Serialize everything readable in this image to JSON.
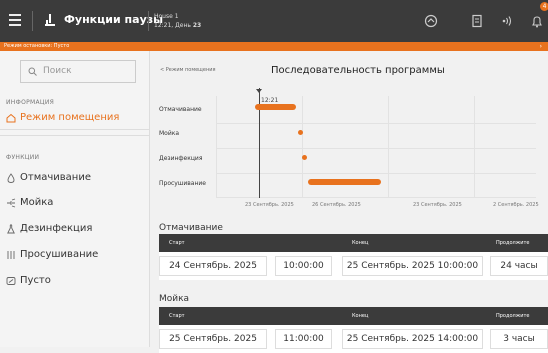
{
  "topbar": {
    "title": "Функции паузы",
    "house_line1": "House 1",
    "house_line2_prefix": "12:21, День ",
    "house_line2_day": "23",
    "badge": "4"
  },
  "statusbar": {
    "text": "Режим остановки: Пусто",
    "icon": "chevron-icon"
  },
  "sidebar": {
    "search_placeholder": "Поиск",
    "info_label": "ИНФОРМАЦИЯ",
    "functions_label": "ФУНКЦИИ",
    "items_info": [
      {
        "label": "Режим помещения",
        "icon": "home-icon",
        "active": true
      }
    ],
    "items_functions": [
      {
        "label": "Отмачивание",
        "icon": "drop-icon"
      },
      {
        "label": "Мойка",
        "icon": "spray-icon"
      },
      {
        "label": "Дезинфекция",
        "icon": "flask-icon"
      },
      {
        "label": "Просушивание",
        "icon": "heat-icon"
      },
      {
        "label": "Пусто",
        "icon": "empty-icon"
      }
    ]
  },
  "main": {
    "breadcrumb": "< Режим помещения",
    "title": "Последовательность программы"
  },
  "chart_data": {
    "type": "gantt",
    "now_label": "12:21",
    "rows": [
      {
        "name": "Отмачивание",
        "start": "2025-09-24T10:00",
        "end": "2025-09-25T10:00"
      },
      {
        "name": "Мойка",
        "start": "2025-09-25T11:00",
        "end": "2025-09-25T14:00"
      },
      {
        "name": "Дезинфекция",
        "start": "2025-09-25T14:00",
        "end": "2025-09-25T16:00"
      },
      {
        "name": "Просушивание",
        "start": "2025-09-25T17:00",
        "end": "2025-09-27T12:00"
      }
    ],
    "x_ticks": [
      "23 Сентябрь. 2025",
      "26 Сентябрь. 2025",
      "23 Сентябрь. 2025",
      "2 Сентябрь. 2025"
    ]
  },
  "sections": [
    {
      "title": "Отмачивание",
      "headers": {
        "start": "Старт",
        "end": "Конец",
        "duration": "Продолжите"
      },
      "row": {
        "start_date": "24 Сентябрь. 2025",
        "start_time": "10:00:00",
        "end": "25 Сентябрь. 2025 10:00:00",
        "duration": "24 часы"
      }
    },
    {
      "title": "Мойка",
      "headers": {
        "start": "Старт",
        "end": "Конец",
        "duration": "Продолжите"
      },
      "row": {
        "start_date": "25 Сентябрь. 2025",
        "start_time": "11:00:00",
        "end": "25 Сентябрь. 2025 14:00:00",
        "duration": "3 часы"
      }
    }
  ],
  "colors": {
    "accent": "#e8721e",
    "topbar": "#3b3b3b"
  }
}
